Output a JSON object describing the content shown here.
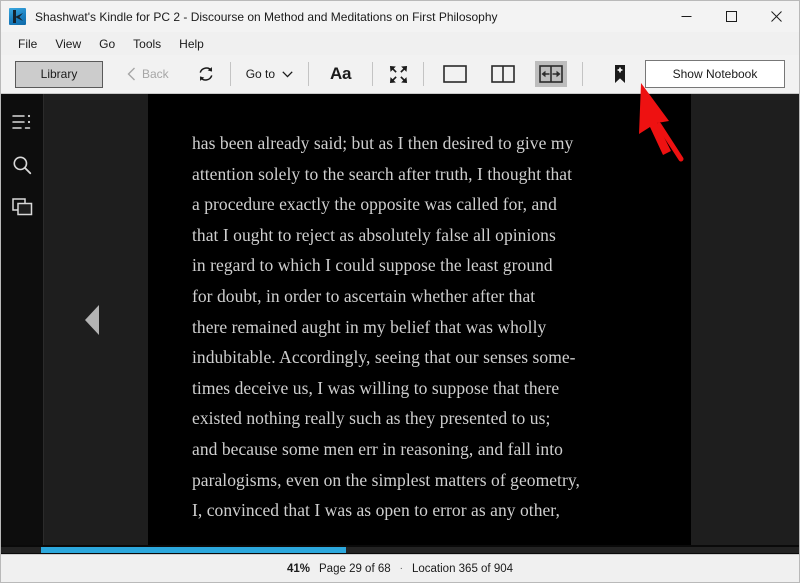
{
  "window": {
    "app_icon": "kindle-app-icon",
    "title": "Shashwat's Kindle for PC 2 - Discourse on Method and Meditations on First Philosophy",
    "controls": {
      "minimize": "minimize-icon",
      "maximize": "maximize-icon",
      "close": "close-icon"
    }
  },
  "menubar": {
    "items": [
      {
        "label": "File"
      },
      {
        "label": "View"
      },
      {
        "label": "Go"
      },
      {
        "label": "Tools"
      },
      {
        "label": "Help"
      }
    ]
  },
  "toolbar": {
    "library_label": "Library",
    "back_label": "Back",
    "back_icon": "chevron-left-icon",
    "refresh_icon": "sync-refresh-icon",
    "goto_label": "Go to",
    "goto_icon": "chevron-down-icon",
    "font_label": "Aa",
    "fullscreen_icon": "expand-fullscreen-icon",
    "view_single_page_icon": "single-page-view-icon",
    "view_two_page_icon": "two-page-view-icon",
    "view_continuous_icon": "continuous-scroll-view-icon",
    "view_active": "continuous",
    "bookmark_icon": "add-bookmark-icon",
    "notebook_label": "Show Notebook"
  },
  "sidebar": {
    "items": [
      {
        "icon": "table-of-contents-icon",
        "name": "contents"
      },
      {
        "icon": "search-icon",
        "name": "search"
      },
      {
        "icon": "flashcards-icon",
        "name": "flashcards"
      }
    ]
  },
  "reader": {
    "prev_page_icon": "previous-page-arrow-icon",
    "page_text": "has been already said; but as I then desired to give my\nattention solely to the search after truth, I thought that\na procedure exactly the opposite was called for, and\nthat I ought to reject as absolutely false all opinions\nin regard to which I could suppose the least ground\nfor doubt, in order to ascertain whether after that\nthere remained aught in my belief that was wholly\nindubitable. Accordingly, seeing that our senses some-\ntimes deceive us, I was willing to suppose that there\nexisted nothing really such as they presented to us;\nand because some men err in reasoning, and fall into\nparalogisms, even on the simplest matters of geometry,\nI, convinced that I was as open to error as any other,"
  },
  "progress": {
    "percent_value": 41,
    "bar_color": "#2ca8dd"
  },
  "status": {
    "percent": "41%",
    "page": "Page 29 of 68",
    "separator": "·",
    "location": "Location 365 of 904"
  },
  "annotation": {
    "arrow": "red-pointer-arrow",
    "color": "#ee1111"
  }
}
